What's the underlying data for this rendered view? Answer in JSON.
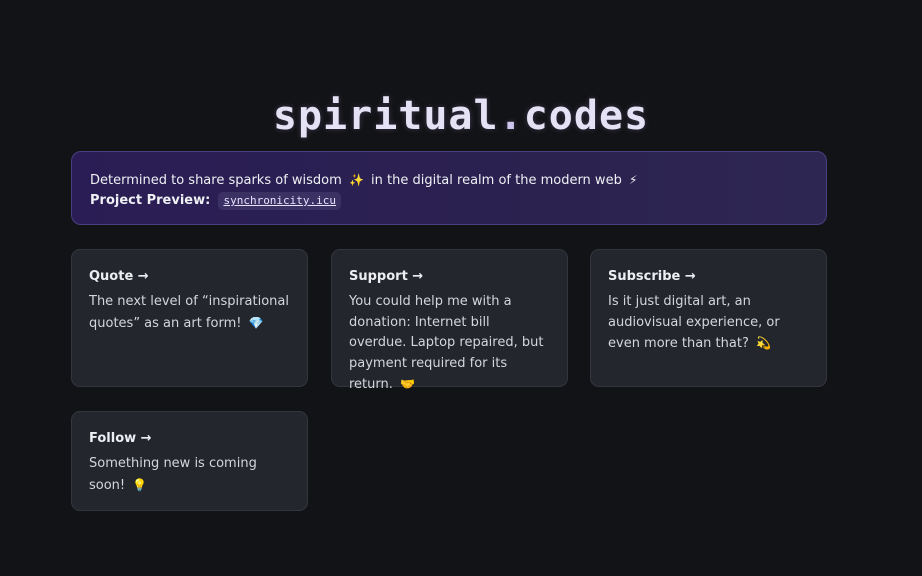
{
  "header": {
    "title_main": "spiritual",
    "title_dot": ".",
    "title_tld": "codes"
  },
  "banner": {
    "line1_a": "Determined to share sparks of wisdom",
    "line1_emoji1": "✨",
    "line1_b": "in the digital realm of the modern web",
    "line1_emoji2": "⚡",
    "preview_label": "Project Preview:",
    "preview_link": "synchronicity.icu"
  },
  "cards": [
    {
      "title": "Quote →",
      "body": "The next level of “inspirational quotes” as an art form!",
      "emoji": "💎"
    },
    {
      "title": "Support →",
      "body": "You could help me with a donation: Internet bill overdue. Laptop repaired, but payment required for its return.",
      "emoji": "🤝"
    },
    {
      "title": "Subscribe →",
      "body": "Is it just digital art, an audiovisual experience, or even more than that?",
      "emoji": "💫"
    },
    {
      "title": "Follow →",
      "body": "Something new is coming soon!",
      "emoji": "💡"
    }
  ],
  "colors": {
    "background": "#121316",
    "banner_gradient_start": "#2a1d55",
    "banner_border": "#4a3f80",
    "card_background": "#23262c",
    "title_color": "#e6e2f6"
  }
}
